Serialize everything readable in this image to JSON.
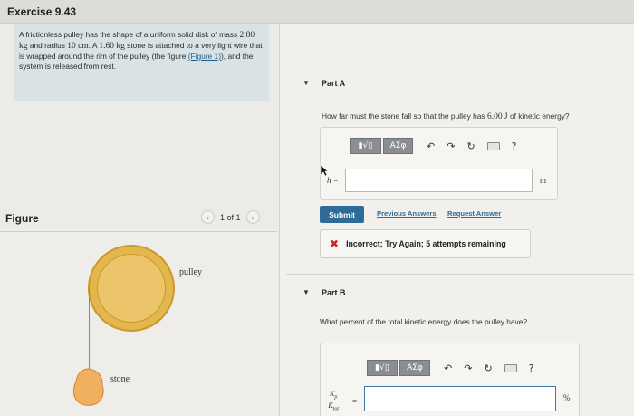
{
  "header": {
    "title": "Exercise 9.43"
  },
  "problem": {
    "t1": "A frictionless pulley has the shape of a uniform solid disk of mass",
    "mass_value": "2.80",
    "mass_unit": "kg",
    "t2": "and radius",
    "radius_value": "10",
    "radius_unit": "cm",
    "t3": ". A",
    "stone_value": "1.60",
    "stone_unit": "kg",
    "t4": "stone is attached to a very light wire that is wrapped around the rim of the pulley (the figure",
    "figure_link": "(Figure 1)",
    "t5": "), and the system is released from rest."
  },
  "figure_panel": {
    "label": "Figure",
    "pager_text": "1 of 1",
    "prev_icon": "chevron-left-icon",
    "next_icon": "chevron-right-icon",
    "pulley_label": "pulley",
    "stone_label": "stone"
  },
  "colors": {
    "pulley_fill": "#e3b74d",
    "stone_fill": "#f0b060",
    "submit_bg": "#2e6b97",
    "incorrect_icon": "#c8272c"
  },
  "part_a": {
    "title": "Part A",
    "question_pre": "How far must the stone fall so that the pulley has",
    "energy_value": "6.00",
    "energy_unit": "J",
    "question_post": "of kinetic energy?",
    "var_label": "h =",
    "input_value": "",
    "unit": "m",
    "toolbar": {
      "template_label": "▮√▯",
      "greek_label": "ΑΣφ",
      "undo_icon": "undo-icon",
      "redo_icon": "redo-icon",
      "reset_icon": "reset-icon",
      "keyboard_icon": "keyboard-icon",
      "help_label": "?"
    },
    "submit_label": "Submit",
    "previous_answers_label": "Previous Answers",
    "request_answer_label": "Request Answer",
    "feedback": "Incorrect; Try Again; 5 attempts remaining"
  },
  "part_b": {
    "title": "Part B",
    "question": "What percent of the total kinetic energy does the pulley have?",
    "frac_num": "K",
    "frac_num_sub": "p",
    "frac_den": "K",
    "frac_den_sub": "tot",
    "equals": "=",
    "input_value": "",
    "unit": "%",
    "toolbar": {
      "template_label": "▮√▯",
      "greek_label": "ΑΣφ",
      "undo_icon": "undo-icon",
      "redo_icon": "redo-icon",
      "reset_icon": "reset-icon",
      "keyboard_icon": "keyboard-icon",
      "help_label": "?"
    }
  }
}
